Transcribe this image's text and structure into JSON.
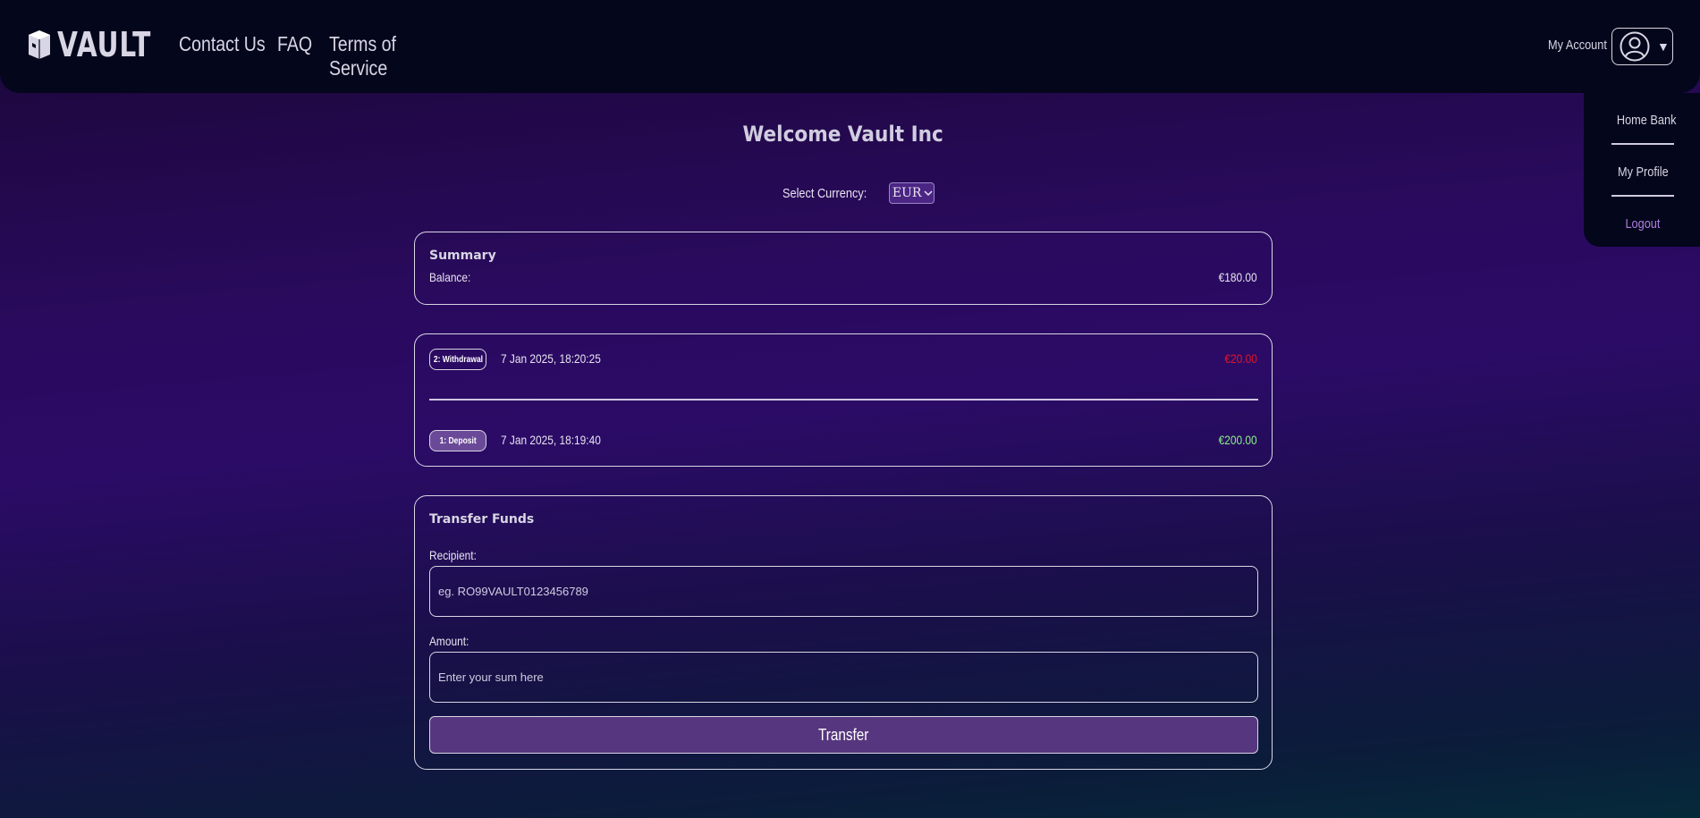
{
  "header": {
    "logo_text": "VAULT",
    "nav": [
      "Contact Us",
      "FAQ",
      "Terms of Service"
    ],
    "account_label": "My Account"
  },
  "account_menu": {
    "items": [
      "Home Bank",
      "My Profile",
      "Logout"
    ]
  },
  "main": {
    "title": "Welcome Vault Inc",
    "currency_label": "Select Currency:",
    "currency_value": "EUR"
  },
  "summary": {
    "title": "Summary",
    "balance_label": "Balance:",
    "balance_value": "€180.00"
  },
  "transactions": [
    {
      "badge": "2: Withdrawal",
      "date": "7 Jan 2025, 18:20:25",
      "amount": "€20.00",
      "type": "withdrawal"
    },
    {
      "badge": "1: Deposit",
      "date": "7 Jan 2025, 18:19:40",
      "amount": "€200.00",
      "type": "deposit"
    }
  ],
  "transfer": {
    "title": "Transfer Funds",
    "recipient_label": "Recipient:",
    "recipient_placeholder": "eg. RO99VAULT0123456789",
    "recipient_value": "",
    "amount_label": "Amount:",
    "amount_placeholder": "Enter your sum here",
    "amount_value": "",
    "button_label": "Transfer"
  },
  "colors": {
    "header_bg": "#04061c",
    "accent": "#56367e",
    "negative": "#e0152a",
    "positive": "#8ef08a",
    "logout": "#b07fe0"
  }
}
